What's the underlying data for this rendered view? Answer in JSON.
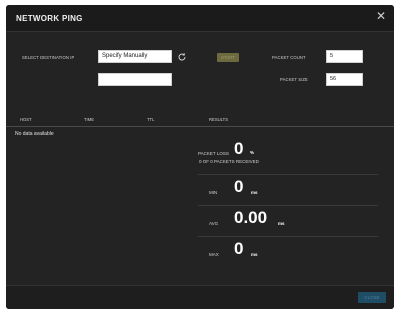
{
  "dialog": {
    "title": "NETWORK PING",
    "close_glyph": "✕"
  },
  "form": {
    "destination_label": "SELECT DESTINATION IP",
    "destination_mode": "Specify Manually",
    "destination_ip": "",
    "start_label": "START",
    "packet_count_label": "PACKET COUNT",
    "packet_count": "5",
    "packet_size_label": "PACKET SIZE",
    "packet_size": "56"
  },
  "table": {
    "headers": [
      "HOST",
      "TIME",
      "TTL"
    ],
    "results_label": "RESULTS",
    "empty_text": "No data available"
  },
  "results": {
    "packet_loss_label": "PACKET LOSS",
    "packet_loss_value": "0",
    "packet_loss_unit": "%",
    "received_text": "0  OF  0 PACKETS RECEIVED",
    "min_label": "MIN",
    "min_value": "0",
    "min_unit": "ms",
    "avg_label": "AVG",
    "avg_value": "0.00",
    "avg_unit": "ms",
    "max_label": "MAX",
    "max_value": "0",
    "max_unit": "ms"
  },
  "footer": {
    "close_label": "CLOSE"
  },
  "colors": {
    "dialog_bg": "#232323",
    "start_button": "#6d6a3f",
    "close_button": "#1f4d66"
  },
  "icons": {
    "refresh": "refresh-icon",
    "close": "close-icon"
  }
}
